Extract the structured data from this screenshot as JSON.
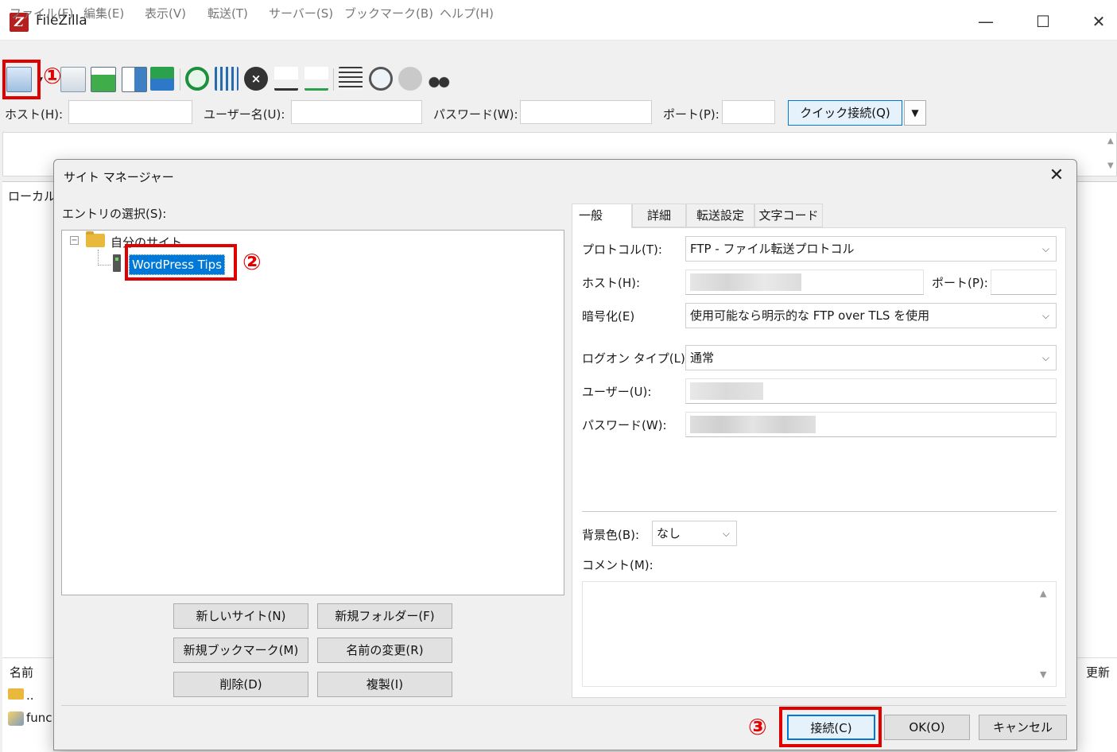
{
  "window": {
    "app_name": "FileZilla",
    "minimize": "—",
    "maximize": "☐",
    "close": "✕"
  },
  "menu": [
    "ファイル(F)",
    "編集(E)",
    "表示(V)",
    "転送(T)",
    "サーバー(S)",
    "ブックマーク(B)",
    "ヘルプ(H)"
  ],
  "quickconnect": {
    "host_label": "ホスト(H):",
    "user_label": "ユーザー名(U):",
    "password_label": "パスワード(W):",
    "port_label": "ポート(P):",
    "button_label": "クイック接続(Q)",
    "dropdown_arrow": "▼"
  },
  "background": {
    "local_label": "ローカル",
    "col_name": "名前",
    "col_updated": "更新",
    "file1": "..",
    "file2": "func"
  },
  "dialog": {
    "title": "サイト マネージャー",
    "close": "✕",
    "entry_label": "エントリの選択(S):",
    "tree": {
      "expander": "−",
      "root": "自分のサイト",
      "site": "WordPress Tips"
    },
    "buttons": {
      "new_site": "新しいサイト(N)",
      "new_folder": "新規フォルダー(F)",
      "new_bookmark": "新規ブックマーク(M)",
      "rename": "名前の変更(R)",
      "delete": "削除(D)",
      "duplicate": "複製(I)"
    },
    "tabs": [
      "一般",
      "詳細",
      "転送設定",
      "文字コード"
    ],
    "general": {
      "protocol_label": "プロトコル(T):",
      "protocol_value": "FTP - ファイル転送プロトコル",
      "host_label": "ホスト(H):",
      "port_label": "ポート(P):",
      "encryption_label": "暗号化(E)",
      "encryption_value": "使用可能なら明示的な FTP over TLS を使用",
      "logon_label": "ログオン タイプ(L):",
      "logon_value": "通常",
      "user_label": "ユーザー(U):",
      "password_label": "パスワード(W):",
      "bgcolor_label": "背景色(B):",
      "bgcolor_value": "なし",
      "comment_label": "コメント(M):"
    },
    "footer": {
      "connect": "接続(C)",
      "ok": "OK(O)",
      "cancel": "キャンセル"
    }
  },
  "annotations": {
    "step1": "①",
    "step2": "②",
    "step3": "③",
    "color": "#e00000"
  }
}
